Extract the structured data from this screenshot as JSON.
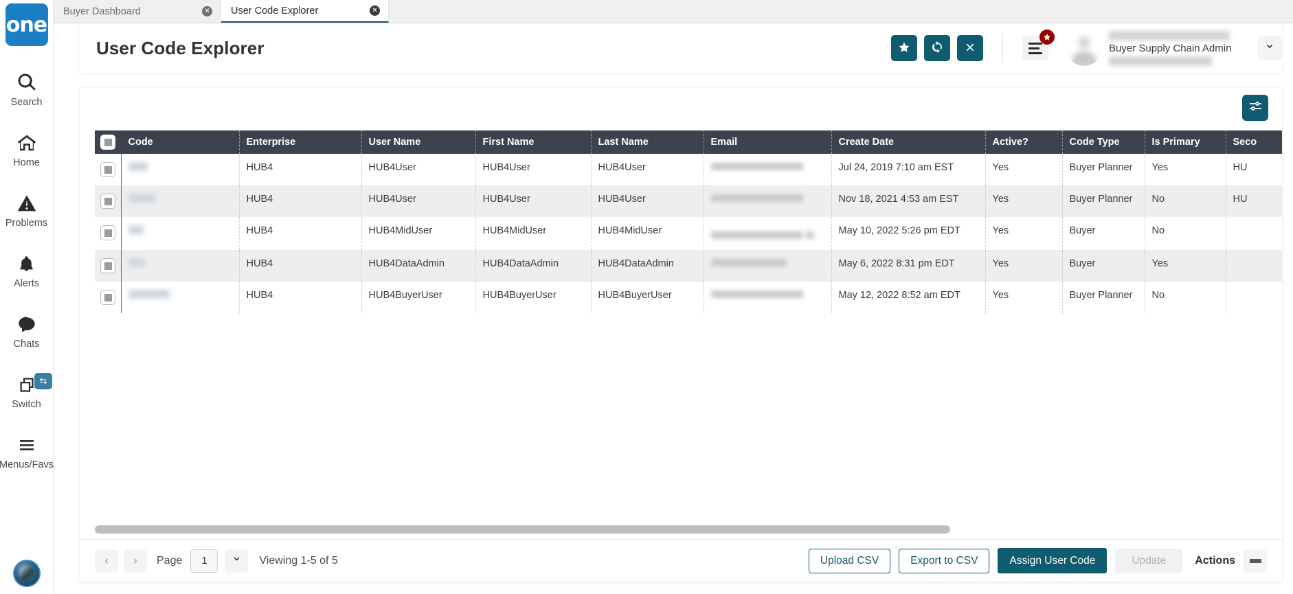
{
  "brand": {
    "logo_text": "one"
  },
  "rail": {
    "items": [
      {
        "label": "Search",
        "icon": "search-icon"
      },
      {
        "label": "Home",
        "icon": "home-icon"
      },
      {
        "label": "Problems",
        "icon": "warning-triangle-icon"
      },
      {
        "label": "Alerts",
        "icon": "bell-icon"
      },
      {
        "label": "Chats",
        "icon": "chat-bubble-icon"
      },
      {
        "label": "Switch",
        "icon": "switch-windows-icon",
        "badge_icon": "swap-arrows-icon"
      },
      {
        "label": "Menus/Favs",
        "icon": "hamburger-icon"
      }
    ]
  },
  "tabs": [
    {
      "label": "Buyer Dashboard",
      "active": false,
      "close_icon": "close-circle-icon"
    },
    {
      "label": "User Code Explorer",
      "active": true,
      "close_icon": "close-circle-icon"
    }
  ],
  "header": {
    "title": "User Code Explorer",
    "buttons": [
      {
        "name": "favorite-button",
        "icon": "star-icon"
      },
      {
        "name": "refresh-button",
        "icon": "refresh-icon"
      },
      {
        "name": "close-button",
        "icon": "x-icon"
      }
    ],
    "menu_button": {
      "icon": "hamburger-icon",
      "badge_icon": "star-icon"
    },
    "profile": {
      "name_redacted": "",
      "role": "Buyer Supply Chain Admin",
      "email_redacted": "",
      "caret_icon": "chevron-down-icon"
    }
  },
  "toolbar": {
    "filter_button": {
      "icon": "sliders-icon"
    }
  },
  "table": {
    "columns": [
      "Code",
      "Enterprise",
      "User Name",
      "First Name",
      "Last Name",
      "Email",
      "Create Date",
      "Active?",
      "Code Type",
      "Is Primary",
      "Seco"
    ],
    "rows": [
      {
        "code": "",
        "enterprise": "HUB4",
        "user_name": "HUB4User",
        "first_name": "HUB4User",
        "last_name": "HUB4User",
        "email": "",
        "create_date": "Jul 24, 2019 7:10 am EST",
        "active": "Yes",
        "code_type": "Buyer Planner",
        "is_primary": "Yes",
        "secondary": "HU"
      },
      {
        "code": "",
        "enterprise": "HUB4",
        "user_name": "HUB4User",
        "first_name": "HUB4User",
        "last_name": "HUB4User",
        "email": "",
        "create_date": "Nov 18, 2021 4:53 am EST",
        "active": "Yes",
        "code_type": "Buyer Planner",
        "is_primary": "No",
        "secondary": "HU"
      },
      {
        "code": "",
        "enterprise": "HUB4",
        "user_name": "HUB4MidUser",
        "first_name": "HUB4MidUser",
        "last_name": "HUB4MidUser",
        "email": "",
        "create_date": "May 10, 2022 5:26 pm EDT",
        "active": "Yes",
        "code_type": "Buyer",
        "is_primary": "No",
        "secondary": ""
      },
      {
        "code": "",
        "enterprise": "HUB4",
        "user_name": "HUB4DataAdmin",
        "first_name": "HUB4DataAdmin",
        "last_name": "HUB4DataAdmin",
        "email": "",
        "create_date": "May 6, 2022 8:31 pm EDT",
        "active": "Yes",
        "code_type": "Buyer",
        "is_primary": "Yes",
        "secondary": ""
      },
      {
        "code": "",
        "enterprise": "HUB4",
        "user_name": "HUB4BuyerUser",
        "first_name": "HUB4BuyerUser",
        "last_name": "HUB4BuyerUser",
        "email": "",
        "create_date": "May 12, 2022 8:52 am EDT",
        "active": "Yes",
        "code_type": "Buyer Planner",
        "is_primary": "No",
        "secondary": ""
      }
    ]
  },
  "footer": {
    "prev_icon": "chevron-left-icon",
    "next_icon": "chevron-right-icon",
    "page_label": "Page",
    "page_value": "1",
    "page_caret_icon": "chevron-down-icon",
    "viewing": "Viewing 1-5 of 5",
    "upload_csv": "Upload CSV",
    "export_csv": "Export to CSV",
    "assign_user_code": "Assign User Code",
    "update": "Update",
    "actions": "Actions",
    "actions_menu_icon": "hamburger-icon"
  },
  "colors": {
    "accent_teal": "#0f5b70",
    "brand_blue": "#1c7ec4",
    "header_dark": "#3c434f",
    "badge_red": "#990000"
  }
}
